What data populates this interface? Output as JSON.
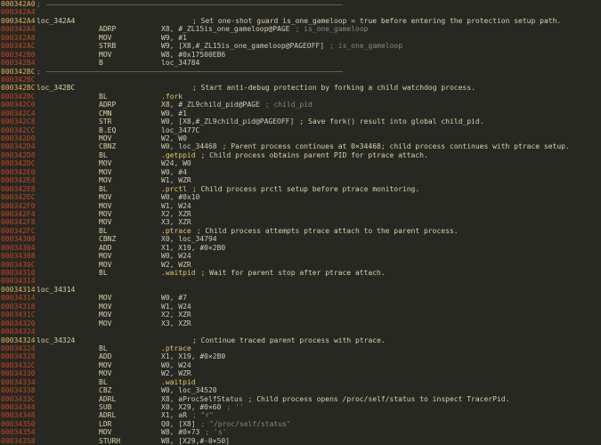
{
  "rows": [
    {
      "addr": "000342A0",
      "type": "sep"
    },
    {
      "addr": "000342A4",
      "type": "blank"
    },
    {
      "addr": "000342A4",
      "label": "loc_342A4",
      "comment": "; Set one-shot guard is_one_gameloop = true before entering the protection setup path."
    },
    {
      "addr": "000342A4",
      "mn": "ADRP",
      "ops": "X8, #_ZL15is_one_gameloop@PAGE",
      "cmt2": "; is_one_gameloop"
    },
    {
      "addr": "000342A8",
      "mn": "MOV",
      "ops": "W9, #1"
    },
    {
      "addr": "000342AC",
      "mn": "STRB",
      "ops": "W9, [X8,#_ZL15is_one_gameloop@PAGEOFF]",
      "cmt2": "; is_one_gameloop"
    },
    {
      "addr": "000342B0",
      "mn": "MOV",
      "ops": "W8, #0x17500EB6"
    },
    {
      "addr": "000342B4",
      "mn": "B",
      "ops": "loc_34784"
    },
    {
      "addr": "000342BC",
      "type": "sep"
    },
    {
      "addr": "000342BC",
      "type": "blank"
    },
    {
      "addr": "000342BC",
      "label": "loc_342BC",
      "comment": "; Start anti-debug protection by forking a child watchdog process."
    },
    {
      "addr": "000342BC",
      "mn": "BL",
      "ops": ".fork"
    },
    {
      "addr": "000342C0",
      "mn": "ADRP",
      "ops": "X8, #_ZL9child_pid@PAGE",
      "cmt2": "; child_pid"
    },
    {
      "addr": "000342C4",
      "mn": "CMN",
      "ops": "W0, #1"
    },
    {
      "addr": "000342C8",
      "mn": "STR",
      "ops": "W0, [X8,#_ZL9child_pid@PAGEOFF]",
      "comment": "; Save fork() result into global child_pid."
    },
    {
      "addr": "000342CC",
      "mn": "B.EQ",
      "ops": "loc_3477C"
    },
    {
      "addr": "000342D0",
      "mn": "MOV",
      "ops": "W2, W0"
    },
    {
      "addr": "000342D4",
      "mn": "CBNZ",
      "ops": "W0, loc_34468",
      "comment": "; Parent process continues at 0×34468; child process continues with ptrace setup."
    },
    {
      "addr": "000342D8",
      "mn": "BL",
      "ops": ".getppid",
      "comment": "; Child process obtains parent PID for ptrace attach."
    },
    {
      "addr": "000342DC",
      "mn": "MOV",
      "ops": "W24, W0"
    },
    {
      "addr": "000342E0",
      "mn": "MOV",
      "ops": "W0, #4"
    },
    {
      "addr": "000342E4",
      "mn": "MOV",
      "ops": "W1, WZR"
    },
    {
      "addr": "000342E8",
      "mn": "BL",
      "ops": ".prctl",
      "comment": "; Child process prctl setup before ptrace monitoring."
    },
    {
      "addr": "000342EC",
      "mn": "MOV",
      "ops": "W0, #0x10"
    },
    {
      "addr": "000342F0",
      "mn": "MOV",
      "ops": "W1, W24"
    },
    {
      "addr": "000342F4",
      "mn": "MOV",
      "ops": "X2, XZR"
    },
    {
      "addr": "000342F8",
      "mn": "MOV",
      "ops": "X3, XZR"
    },
    {
      "addr": "000342FC",
      "mn": "BL",
      "ops": ".ptrace",
      "comment": "; Child process attempts ptrace attach to the parent process."
    },
    {
      "addr": "00034300",
      "mn": "CBNZ",
      "ops": "X0, loc_34794"
    },
    {
      "addr": "00034304",
      "mn": "ADD",
      "ops": "X1, X19, #0×2B0"
    },
    {
      "addr": "00034308",
      "mn": "MOV",
      "ops": "W0, W24"
    },
    {
      "addr": "0003430C",
      "mn": "MOV",
      "ops": "W2, WZR"
    },
    {
      "addr": "00034310",
      "mn": "BL",
      "ops": ".waitpid",
      "comment": "; Wait for parent stop after ptrace attach."
    },
    {
      "addr": "00034314",
      "type": "blank"
    },
    {
      "addr": "00034314",
      "label": "loc_34314"
    },
    {
      "addr": "00034314",
      "mn": "MOV",
      "ops": "W0, #7"
    },
    {
      "addr": "00034318",
      "mn": "MOV",
      "ops": "W1, W24"
    },
    {
      "addr": "0003431C",
      "mn": "MOV",
      "ops": "X2, XZR"
    },
    {
      "addr": "00034320",
      "mn": "MOV",
      "ops": "X3, XZR"
    },
    {
      "addr": "00034324",
      "type": "blank"
    },
    {
      "addr": "00034324",
      "label": "loc_34324",
      "comment": "; Continue traced parent process with ptrace."
    },
    {
      "addr": "00034324",
      "mn": "BL",
      "ops": ".ptrace"
    },
    {
      "addr": "00034328",
      "mn": "ADD",
      "ops": "X1, X19, #0×2B0"
    },
    {
      "addr": "0003432C",
      "mn": "MOV",
      "ops": "W0, W24"
    },
    {
      "addr": "00034330",
      "mn": "MOV",
      "ops": "W2, WZR"
    },
    {
      "addr": "00034334",
      "mn": "BL",
      "ops": ".waitpid"
    },
    {
      "addr": "00034338",
      "mn": "CBZ",
      "ops": "W0, loc_34520"
    },
    {
      "addr": "0003433C",
      "mn": "ADRL",
      "ops": "X8, aProcSelfStatus",
      "comment": "; Child process opens /proc/self/status to inspect TracerPid."
    },
    {
      "addr": "00034344",
      "mn": "SUB",
      "ops": "X0, X29, #0×60",
      "cmt2": "; ''"
    },
    {
      "addr": "00034348",
      "mn": "ADRL",
      "ops": "X1, aR",
      "cmt2": "; \"r\""
    },
    {
      "addr": "00034350",
      "mn": "LDR",
      "ops": "Q0, [X8]",
      "cmt2": "; \"/proc/self/status\""
    },
    {
      "addr": "00034354",
      "mn": "MOV",
      "ops": "W8, #0×73",
      "cmt2": "; 's'"
    },
    {
      "addr": "00034358",
      "mn": "STURH",
      "ops": "W8, [X29,#-0×50]"
    }
  ]
}
